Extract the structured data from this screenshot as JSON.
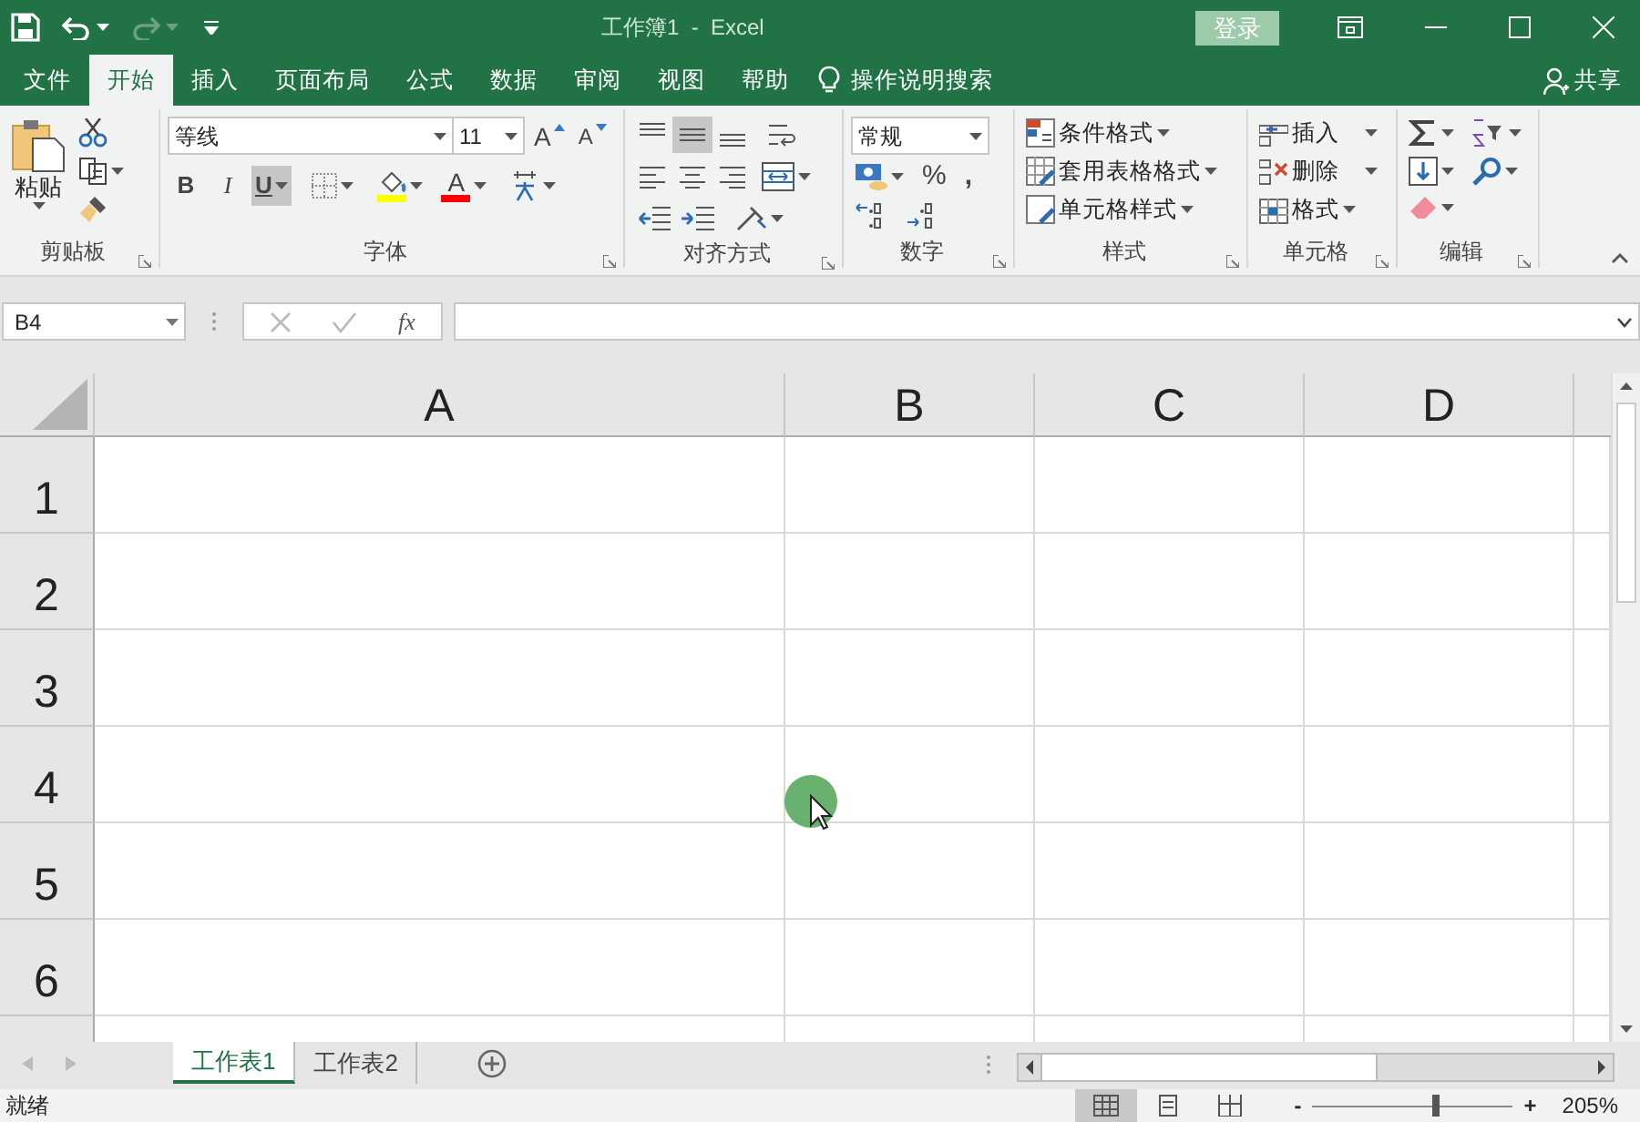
{
  "title_bar": {
    "title": "工作簿1  -  Excel",
    "login_button": "登录"
  },
  "menu_tabs": [
    {
      "label": "文件",
      "selected": false
    },
    {
      "label": "开始",
      "selected": true
    },
    {
      "label": "插入",
      "selected": false
    },
    {
      "label": "页面布局",
      "selected": false
    },
    {
      "label": "公式",
      "selected": false
    },
    {
      "label": "数据",
      "selected": false
    },
    {
      "label": "审阅",
      "selected": false
    },
    {
      "label": "视图",
      "selected": false
    },
    {
      "label": "帮助",
      "selected": false
    }
  ],
  "tell_me": "操作说明搜索",
  "share": "共享",
  "ribbon": {
    "clipboard": {
      "paste": "粘贴",
      "label": "剪贴板"
    },
    "font": {
      "font_name": "等线",
      "font_size": "11",
      "grow": "A",
      "shrink": "A",
      "styles": [
        {
          "label": "B",
          "kind": "bold",
          "selected": false
        },
        {
          "label": "I",
          "kind": "italic",
          "selected": false
        },
        {
          "label": "U",
          "kind": "underline",
          "selected": true
        }
      ],
      "font_color": "A",
      "label": "字体"
    },
    "alignment": {
      "vertical": [
        {
          "kind": "top",
          "selected": false
        },
        {
          "kind": "middle",
          "selected": true
        },
        {
          "kind": "bottom",
          "selected": false
        }
      ],
      "label": "对齐方式"
    },
    "number": {
      "format": "常规",
      "percent": "%",
      "comma": ",",
      "label": "数字"
    },
    "styles": {
      "items": [
        "条件格式",
        "套用表格格式",
        "单元格样式"
      ],
      "label": "样式"
    },
    "cells": {
      "items": [
        "插入",
        "删除",
        "格式"
      ],
      "label": "单元格"
    },
    "editing": {
      "label": "编辑"
    }
  },
  "formula_bar": {
    "name_box": "B4",
    "function_button": "fx"
  },
  "sheet": {
    "columns": [
      "A",
      "B",
      "C",
      "D"
    ],
    "rows": [
      "1",
      "2",
      "3",
      "4",
      "5",
      "6"
    ]
  },
  "sheet_tabs": [
    {
      "label": "工作表1",
      "selected": true
    },
    {
      "label": "工作表2",
      "selected": false
    }
  ],
  "status_bar": {
    "status": "就绪",
    "views": [
      {
        "kind": "normal",
        "selected": true
      },
      {
        "kind": "page_layout",
        "selected": false
      },
      {
        "kind": "page_break",
        "selected": false
      }
    ],
    "zoom_out": "-",
    "zoom_in": "+",
    "zoom": {
      "level": 0.62
    },
    "zoom_label": "205%"
  }
}
